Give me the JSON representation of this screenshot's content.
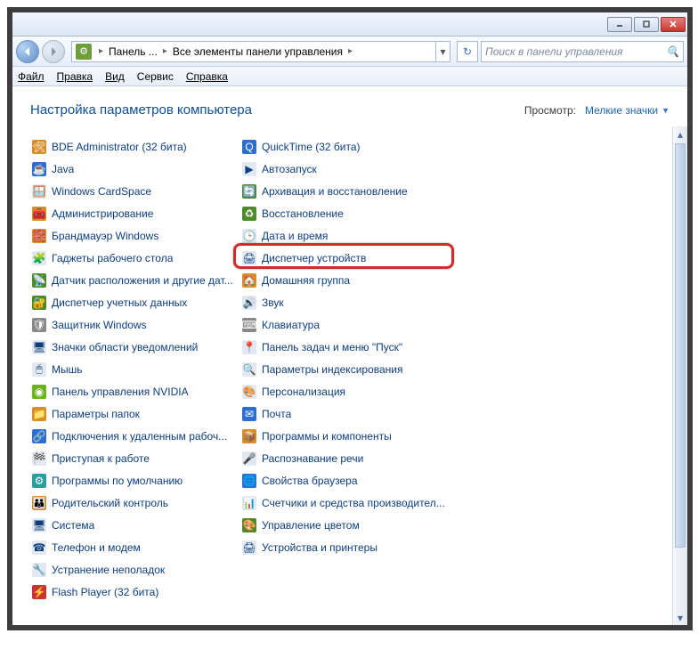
{
  "title_buttons": {
    "min": "—",
    "max": "▭",
    "close": "✕"
  },
  "breadcrumb": {
    "item1": "Панель ...",
    "item2": "Все элементы панели управления"
  },
  "search": {
    "placeholder": "Поиск в панели управления"
  },
  "menu": {
    "file": "Файл",
    "edit": "Правка",
    "view": "Вид",
    "tools": "Сервис",
    "help": "Справка"
  },
  "header": {
    "title": "Настройка параметров компьютера",
    "view_label": "Просмотр:",
    "view_value": "Мелкие значки"
  },
  "items_col1": [
    {
      "name": "bde-administrator",
      "icon": "🛠",
      "cls": "ic-orange",
      "label": "BDE Administrator (32 бита)"
    },
    {
      "name": "java",
      "icon": "☕",
      "cls": "ic-blue",
      "label": "Java"
    },
    {
      "name": "windows-cardspace",
      "icon": "🪟",
      "cls": "ic-generic",
      "label": "Windows CardSpace"
    },
    {
      "name": "admin-tools",
      "icon": "🧰",
      "cls": "ic-orange",
      "label": "Администрирование"
    },
    {
      "name": "firewall",
      "icon": "🧱",
      "cls": "ic-orange",
      "label": "Брандмауэр Windows"
    },
    {
      "name": "desktop-gadgets",
      "icon": "🧩",
      "cls": "ic-generic",
      "label": "Гаджеты рабочего стола"
    },
    {
      "name": "location-sensor",
      "icon": "📡",
      "cls": "ic-green",
      "label": "Датчик расположения и другие дат..."
    },
    {
      "name": "credential-manager",
      "icon": "🔐",
      "cls": "ic-green",
      "label": "Диспетчер учетных данных"
    },
    {
      "name": "windows-defender",
      "icon": "🛡",
      "cls": "ic-gray",
      "label": "Защитник Windows"
    },
    {
      "name": "notification-icons",
      "icon": "🖥",
      "cls": "ic-generic",
      "label": "Значки области уведомлений"
    },
    {
      "name": "mouse",
      "icon": "🖱",
      "cls": "ic-generic",
      "label": "Мышь"
    },
    {
      "name": "nvidia-panel",
      "icon": "◉",
      "cls": "ic-nvidia",
      "label": "Панель управления NVIDIA"
    },
    {
      "name": "folder-options",
      "icon": "📁",
      "cls": "ic-orange",
      "label": "Параметры папок"
    },
    {
      "name": "remote-app",
      "icon": "🔗",
      "cls": "ic-blue",
      "label": "Подключения к удаленным рабоч..."
    },
    {
      "name": "getting-started",
      "icon": "🏁",
      "cls": "ic-generic",
      "label": "Приступая к работе"
    },
    {
      "name": "default-programs",
      "icon": "⚙",
      "cls": "ic-teal",
      "label": "Программы по умолчанию"
    },
    {
      "name": "parental-controls",
      "icon": "👪",
      "cls": "ic-orange",
      "label": "Родительский контроль"
    },
    {
      "name": "system",
      "icon": "🖥",
      "cls": "ic-generic",
      "label": "Система"
    },
    {
      "name": "phone-modem",
      "icon": "☎",
      "cls": "ic-generic",
      "label": "Телефон и модем"
    },
    {
      "name": "troubleshoot",
      "icon": "🔧",
      "cls": "ic-generic",
      "label": "Устранение неполадок"
    }
  ],
  "items_col2": [
    {
      "name": "flash-player",
      "icon": "⚡",
      "cls": "ic-red",
      "label": "Flash Player (32 бита)"
    },
    {
      "name": "quicktime",
      "icon": "Q",
      "cls": "ic-blue",
      "label": "QuickTime (32 бита)"
    },
    {
      "name": "autoplay",
      "icon": "▶",
      "cls": "ic-generic",
      "label": "Автозапуск"
    },
    {
      "name": "backup-restore",
      "icon": "🔄",
      "cls": "ic-green",
      "label": "Архивация и восстановление"
    },
    {
      "name": "recovery",
      "icon": "♻",
      "cls": "ic-green",
      "label": "Восстановление"
    },
    {
      "name": "date-time",
      "icon": "🕒",
      "cls": "ic-generic",
      "label": "Дата и время"
    },
    {
      "name": "device-manager",
      "icon": "🖨",
      "cls": "ic-generic",
      "label": "Диспетчер устройств",
      "highlight": true
    },
    {
      "name": "homegroup",
      "icon": "🏠",
      "cls": "ic-orange",
      "label": "Домашняя группа"
    },
    {
      "name": "sound",
      "icon": "🔊",
      "cls": "ic-generic",
      "label": "Звук"
    },
    {
      "name": "keyboard",
      "icon": "⌨",
      "cls": "ic-gray",
      "label": "Клавиатура"
    },
    {
      "name": "taskbar-start",
      "icon": "📍",
      "cls": "ic-generic",
      "label": "Панель задач и меню \"Пуск\""
    },
    {
      "name": "indexing-options",
      "icon": "🔍",
      "cls": "ic-generic",
      "label": "Параметры индексирования"
    },
    {
      "name": "personalization",
      "icon": "🎨",
      "cls": "ic-generic",
      "label": "Персонализация"
    },
    {
      "name": "mail",
      "icon": "✉",
      "cls": "ic-blue",
      "label": "Почта"
    },
    {
      "name": "programs-features",
      "icon": "📦",
      "cls": "ic-orange",
      "label": "Программы и компоненты"
    },
    {
      "name": "speech-recognition",
      "icon": "🎤",
      "cls": "ic-generic",
      "label": "Распознавание речи"
    },
    {
      "name": "internet-options",
      "icon": "🌐",
      "cls": "ic-blue",
      "label": "Свойства браузера"
    },
    {
      "name": "perf-counters",
      "icon": "📊",
      "cls": "ic-generic",
      "label": "Счетчики и средства производител..."
    },
    {
      "name": "color-management",
      "icon": "🎨",
      "cls": "ic-green",
      "label": "Управление цветом"
    },
    {
      "name": "devices-printers",
      "icon": "🖨",
      "cls": "ic-generic",
      "label": "Устройства и принтеры"
    }
  ]
}
